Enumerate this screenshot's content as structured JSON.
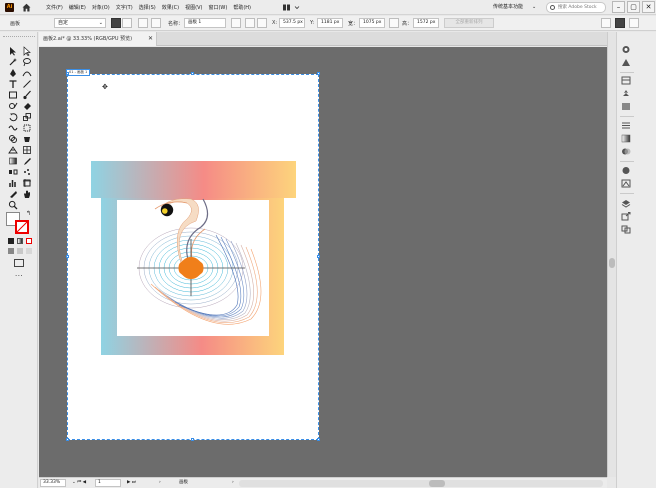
{
  "app": {
    "logo": "Ai"
  },
  "menu": {
    "items": [
      "文件(F)",
      "编辑(E)",
      "对象(O)",
      "文字(T)",
      "选择(S)",
      "效果(C)",
      "视图(V)",
      "窗口(W)",
      "帮助(H)"
    ]
  },
  "workspace": {
    "label": "传统基本功能"
  },
  "search": {
    "placeholder": "搜索 Adobe Stock"
  },
  "control": {
    "selection_label": "画板",
    "preset": "自定",
    "name_label": "名称：",
    "name_value": "画板 1",
    "x_label": "X:",
    "x_value": "537.5 px",
    "y_label": "Y:",
    "y_value": "1181 px",
    "w_label": "宽：",
    "w_value": "1075 px",
    "h_label": "高：",
    "h_value": "1572 px",
    "all_artboards_button": "全部重新排列"
  },
  "document": {
    "tab_title": "画板2.ai* @ 33.33% (RGB/GPU 预览)",
    "artboard_label": "01 - 画板 1"
  },
  "status": {
    "zoom": "33.33%",
    "page": "1",
    "label": "画板"
  },
  "colors": {
    "canvas": "#6c6c6c",
    "selection": "#3a8ee6",
    "accent_orange": "#f07f1a"
  },
  "icons": [
    "ai-logo-icon",
    "home-icon",
    "search-icon",
    "minimize-icon",
    "maximize-icon",
    "close-icon"
  ]
}
